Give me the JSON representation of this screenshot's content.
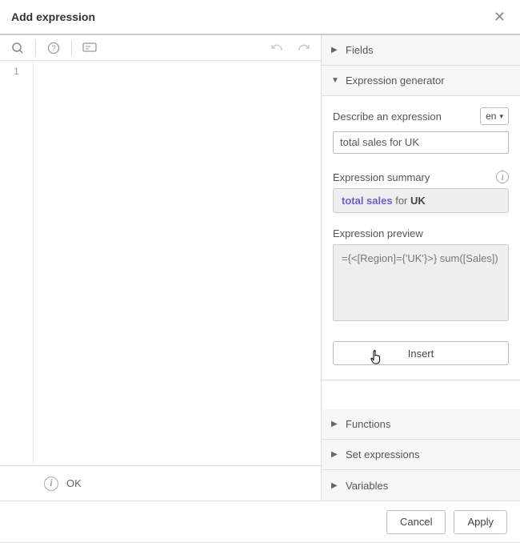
{
  "title": "Add expression",
  "editor": {
    "line_number": "1",
    "status": "OK"
  },
  "panel": {
    "fields_label": "Fields",
    "gen_label": "Expression generator",
    "describe_label": "Describe an expression",
    "lang": "en",
    "expression_input": "total sales for UK",
    "summary_label": "Expression summary",
    "summary_metric": "total sales",
    "summary_middle": " for ",
    "summary_dim": "UK",
    "preview_label": "Expression preview",
    "preview_value": "={<[Region]={'UK'}>} sum([Sales])",
    "insert_label": "Insert",
    "functions_label": "Functions",
    "setexpr_label": "Set expressions",
    "variables_label": "Variables"
  },
  "footer": {
    "cancel": "Cancel",
    "apply": "Apply"
  },
  "chart_data": null
}
